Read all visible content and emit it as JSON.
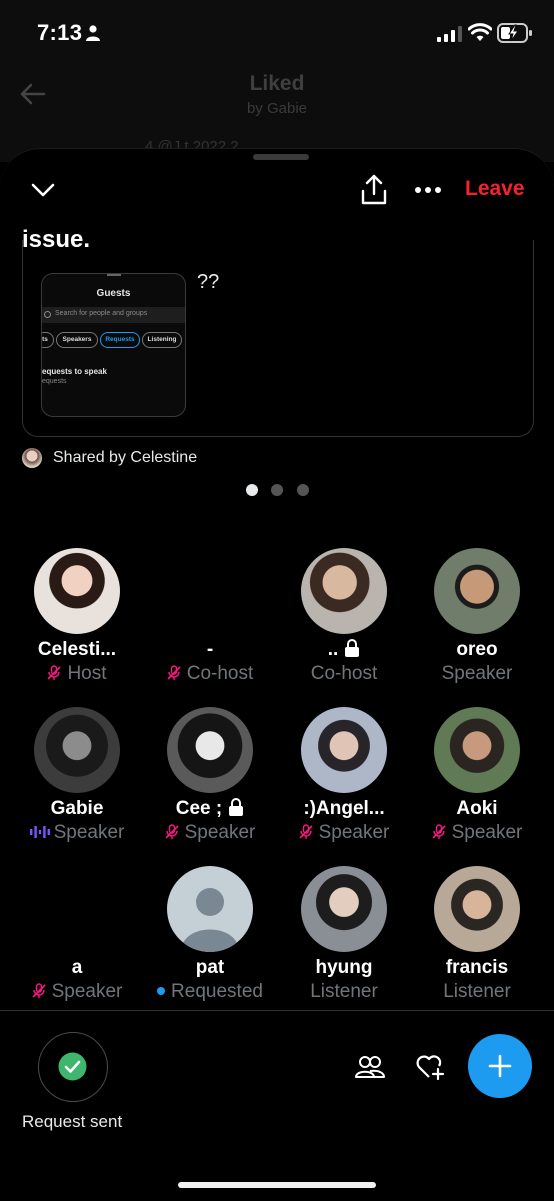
{
  "status_bar": {
    "time": "7:13"
  },
  "background": {
    "title": "Liked",
    "subtitle": "by Gabie",
    "peek_text": "4 @J t  2022  2"
  },
  "space": {
    "leave_label": "Leave",
    "topic_text": "issue.",
    "shared_post": {
      "caption": "??",
      "screenshot": {
        "title": "Guests",
        "search_placeholder": "Search for people and groups",
        "chips": [
          "ts",
          "Speakers",
          "Requests",
          "Listening"
        ],
        "active_chip": "Requests",
        "section": "equests to speak",
        "section_sub": "equests"
      }
    },
    "shared_by": "Shared by Celestine",
    "pagination": {
      "pages": 3,
      "current": 1
    }
  },
  "participants": [
    {
      "name": "Celesti...",
      "role": "Host",
      "status": "muted",
      "has_avatar": true
    },
    {
      "name": "-",
      "role": "Co-host",
      "status": "muted",
      "has_avatar": false
    },
    {
      "name": "..",
      "role": "Co-host",
      "status": "none",
      "has_avatar": true,
      "locked": true
    },
    {
      "name": "oreo",
      "role": "Speaker",
      "status": "none",
      "has_avatar": true
    },
    {
      "name": "Gabie",
      "role": "Speaker",
      "status": "speaking",
      "has_avatar": true
    },
    {
      "name": "Cee ;",
      "role": "Speaker",
      "status": "muted",
      "has_avatar": true,
      "locked": true
    },
    {
      "name": ":)Angel...",
      "role": "Speaker",
      "status": "muted",
      "has_avatar": true
    },
    {
      "name": "Aoki",
      "role": "Speaker",
      "status": "muted",
      "has_avatar": true
    },
    {
      "name": "a",
      "role": "Speaker",
      "status": "muted",
      "has_avatar": false
    },
    {
      "name": "pat",
      "role": "Requested",
      "status": "requested",
      "has_avatar": true,
      "default_avatar": true
    },
    {
      "name": "hyung",
      "role": "Listener",
      "status": "none",
      "has_avatar": true
    },
    {
      "name": "francis",
      "role": "Listener",
      "status": "none",
      "has_avatar": true
    }
  ],
  "footer": {
    "request_label": "Request sent"
  },
  "colors": {
    "accent": "#1d9bf0",
    "leave": "#f4212e",
    "muted_icon": "#f91880",
    "secondary_text": "#71767b",
    "speaking_wave": "#7856ff"
  },
  "icons": [
    "person-icon",
    "cellular-signal-icon",
    "wifi-icon",
    "battery-charging-icon",
    "back-arrow-icon",
    "chevron-down-icon",
    "share-icon",
    "more-icon",
    "mic-off-icon",
    "speaking-wave-icon",
    "lock-icon",
    "check-circle-icon",
    "people-icon",
    "heart-plus-icon",
    "plus-icon"
  ]
}
